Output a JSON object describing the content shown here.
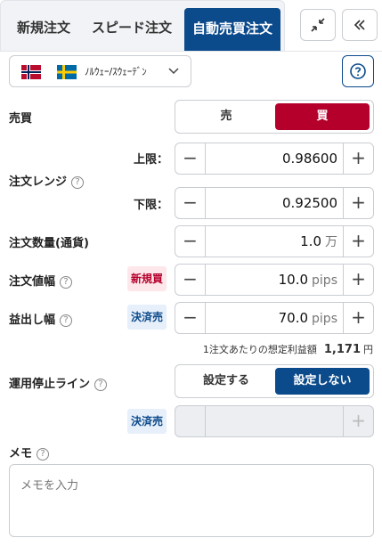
{
  "tabs": [
    "新規注文",
    "スピード注文",
    "自動売買注文"
  ],
  "active_tab": "自動売買注文",
  "header_icons": [
    "collapse-icon",
    "double-chevron-left-icon"
  ],
  "currency": {
    "flags": [
      "norway-flag",
      "sweden-flag"
    ],
    "pair": "ﾉﾙｳｪｰ/ｽｳｪｰﾃﾞﾝ"
  },
  "side": {
    "label": "売買",
    "sell": "売",
    "buy": "買",
    "selected": "買"
  },
  "range": {
    "label": "注文レンジ",
    "upper_label": "上限：",
    "upper_value": "0.98600",
    "lower_label": "下限：",
    "lower_value": "0.92500"
  },
  "quantity": {
    "label": "注文数量(通貨)",
    "value": "1.0",
    "unit": "万"
  },
  "width": {
    "label": "注文値幅",
    "badge": "新規買",
    "value": "10.0",
    "unit": "pips"
  },
  "take_profit": {
    "label": "益出し幅",
    "badge": "決済売",
    "value": "70.0",
    "unit": "pips"
  },
  "estimated_profit": {
    "label": "1注文あたりの想定利益額",
    "value": "1,171",
    "unit": "円"
  },
  "stop_line": {
    "label": "運用停止ライン",
    "on": "設定する",
    "off": "設定しない",
    "selected": "設定しない",
    "badge": "決済売"
  },
  "memo": {
    "label": "メモ",
    "placeholder": "メモを入力"
  },
  "colors": {
    "accent": "#0b4a8b",
    "buy": "#b5002c"
  }
}
